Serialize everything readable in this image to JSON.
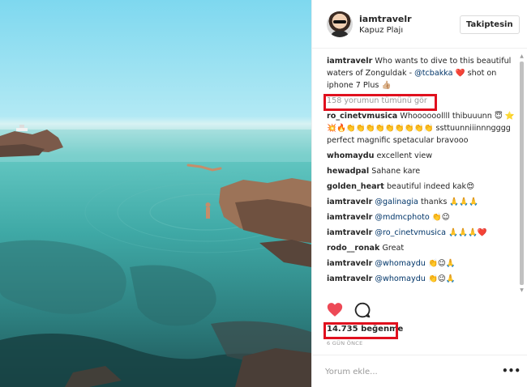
{
  "post": {
    "username": "iamtravelr",
    "location": "Kapuz Plajı",
    "follow_label": "Takiptesin",
    "caption_text": "Who wants to dive to this beautiful waters of Zonguldak -",
    "caption_mention": "@tcbakka",
    "caption_tail": "shot on iphone 7 Plus",
    "caption_emoji_1": "❤️",
    "caption_emoji_2": "👍🏼",
    "view_all_comments": "158 yorumun tümünü gör",
    "likes": "14.735 beğenme",
    "time_ago": "6 GÜN ÖNCE",
    "comment_placeholder": "Yorum ekle...",
    "more_label": "•••"
  },
  "comments": [
    {
      "user": "ro_cinetvmusica",
      "text": "Whoooooollll thibuuunn 😇 ⭐💥🔥👏👏👏👏👏👏👏👏👏 ssttuunniiinnngggg perfect magnific spetacular bravooo"
    },
    {
      "user": "whomaydu",
      "text": "excellent view"
    },
    {
      "user": "hewadpal",
      "text": "Sahane kare"
    },
    {
      "user": "golden_heart",
      "text": "beautiful indeed kak😍"
    },
    {
      "user": "iamtravelr",
      "mention": "@galinagia",
      "text": "thanks 🙏🙏🙏"
    },
    {
      "user": "iamtravelr",
      "mention": "@mdmcphoto",
      "text": "👏😉"
    },
    {
      "user": "iamtravelr",
      "mention": "@ro_cinetvmusica",
      "text": "🙏🙏🙏❤️"
    },
    {
      "user": "rodo__ronak",
      "text": "Great"
    },
    {
      "user": "iamtravelr",
      "mention": "@whomaydu",
      "text": "👏😉🙏"
    },
    {
      "user": "iamtravelr",
      "mention": "@whomaydu",
      "text": "👏😉🙏"
    }
  ],
  "colors": {
    "heart": "#ed4956",
    "mention": "#003569",
    "highlight": "#e0101e"
  },
  "icons": [
    "heart-icon",
    "comment-icon",
    "more-icon"
  ]
}
